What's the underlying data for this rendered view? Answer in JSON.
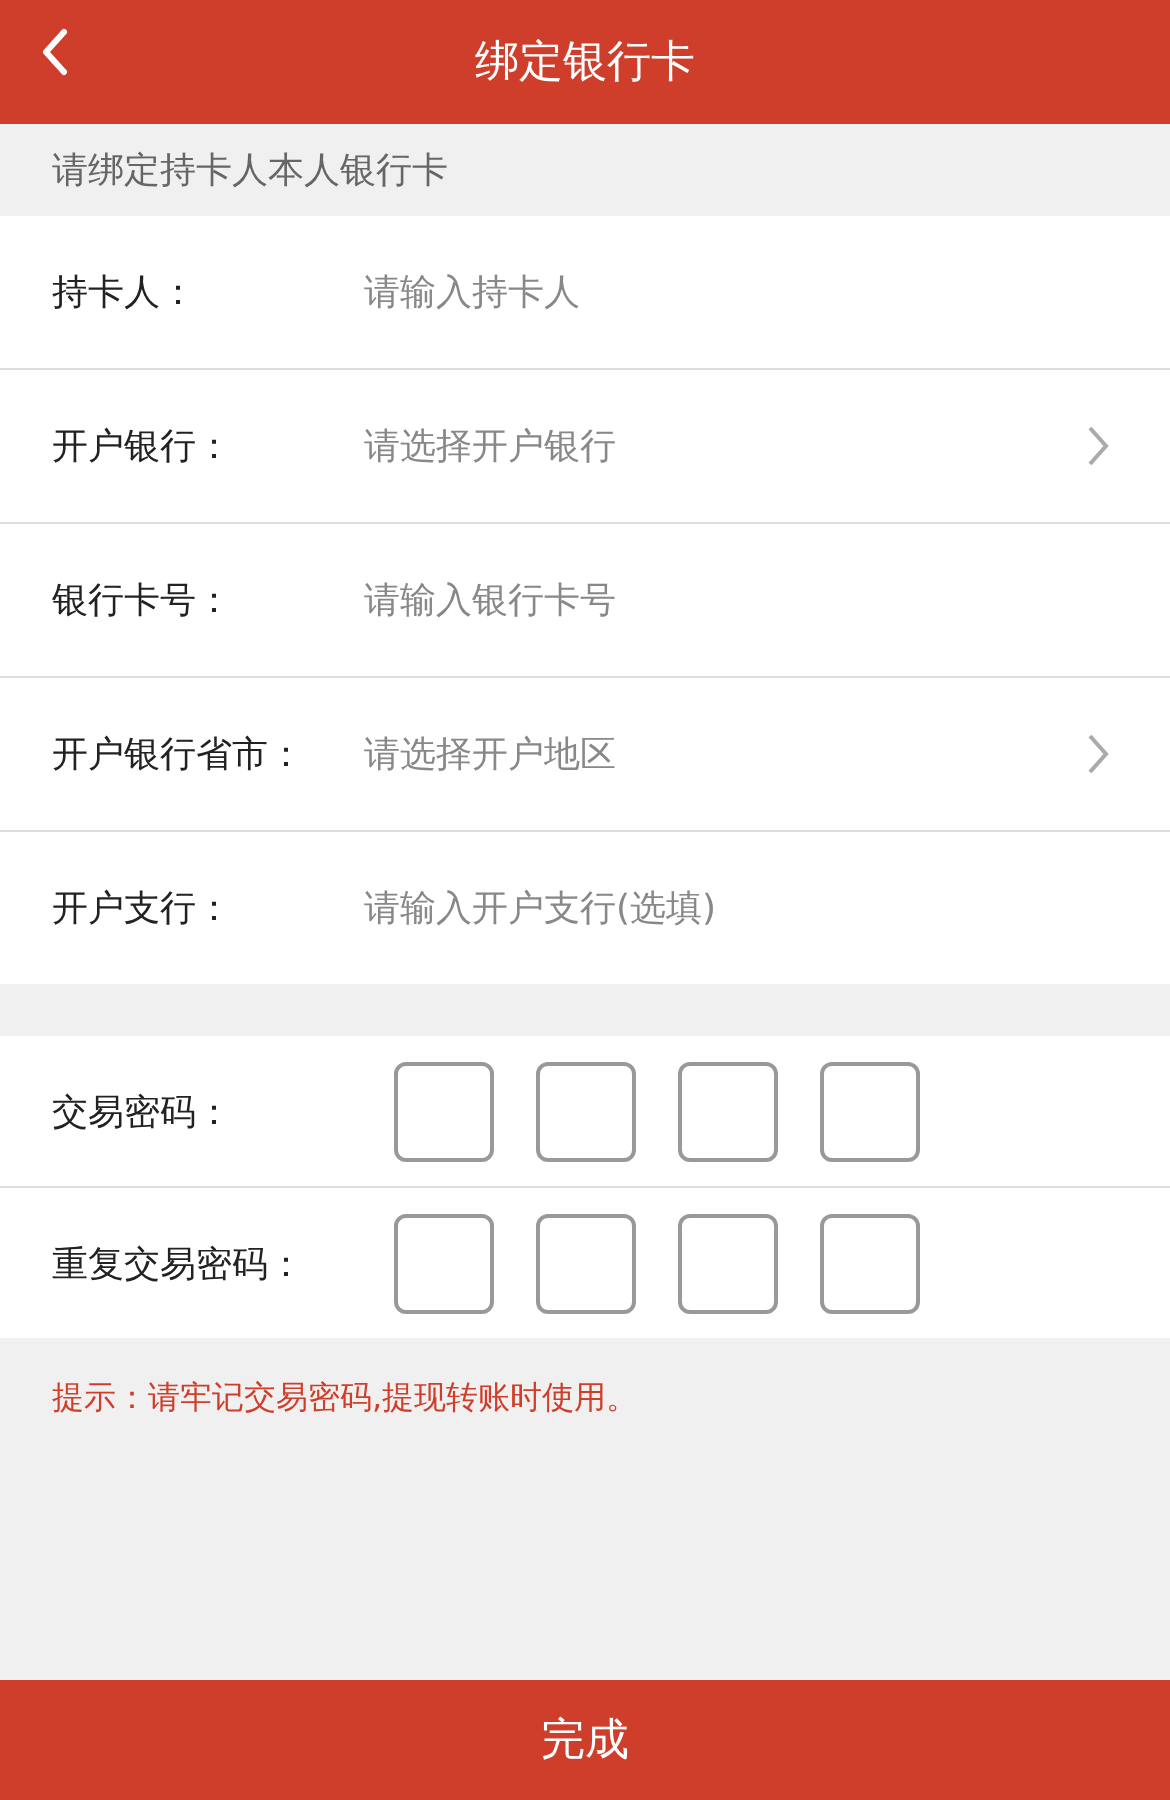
{
  "header": {
    "title": "绑定银行卡"
  },
  "notice": "请绑定持卡人本人银行卡",
  "fields": [
    {
      "kind": "input",
      "label": "持卡人：",
      "placeholder": "请输入持卡人"
    },
    {
      "kind": "select",
      "label": "开户银行：",
      "placeholder": "请选择开户银行"
    },
    {
      "kind": "input",
      "label": "银行卡号：",
      "placeholder": "请输入银行卡号"
    },
    {
      "kind": "select",
      "label": "开户银行省市：",
      "placeholder": "请选择开户地区"
    },
    {
      "kind": "input",
      "label": "开户支行：",
      "placeholder": "请输入开户支行(选填)"
    }
  ],
  "passwords": [
    {
      "label": "交易密码："
    },
    {
      "label": "重复交易密码："
    }
  ],
  "hint": "提示：请牢记交易密码,提现转账时使用。",
  "submit": "完成"
}
